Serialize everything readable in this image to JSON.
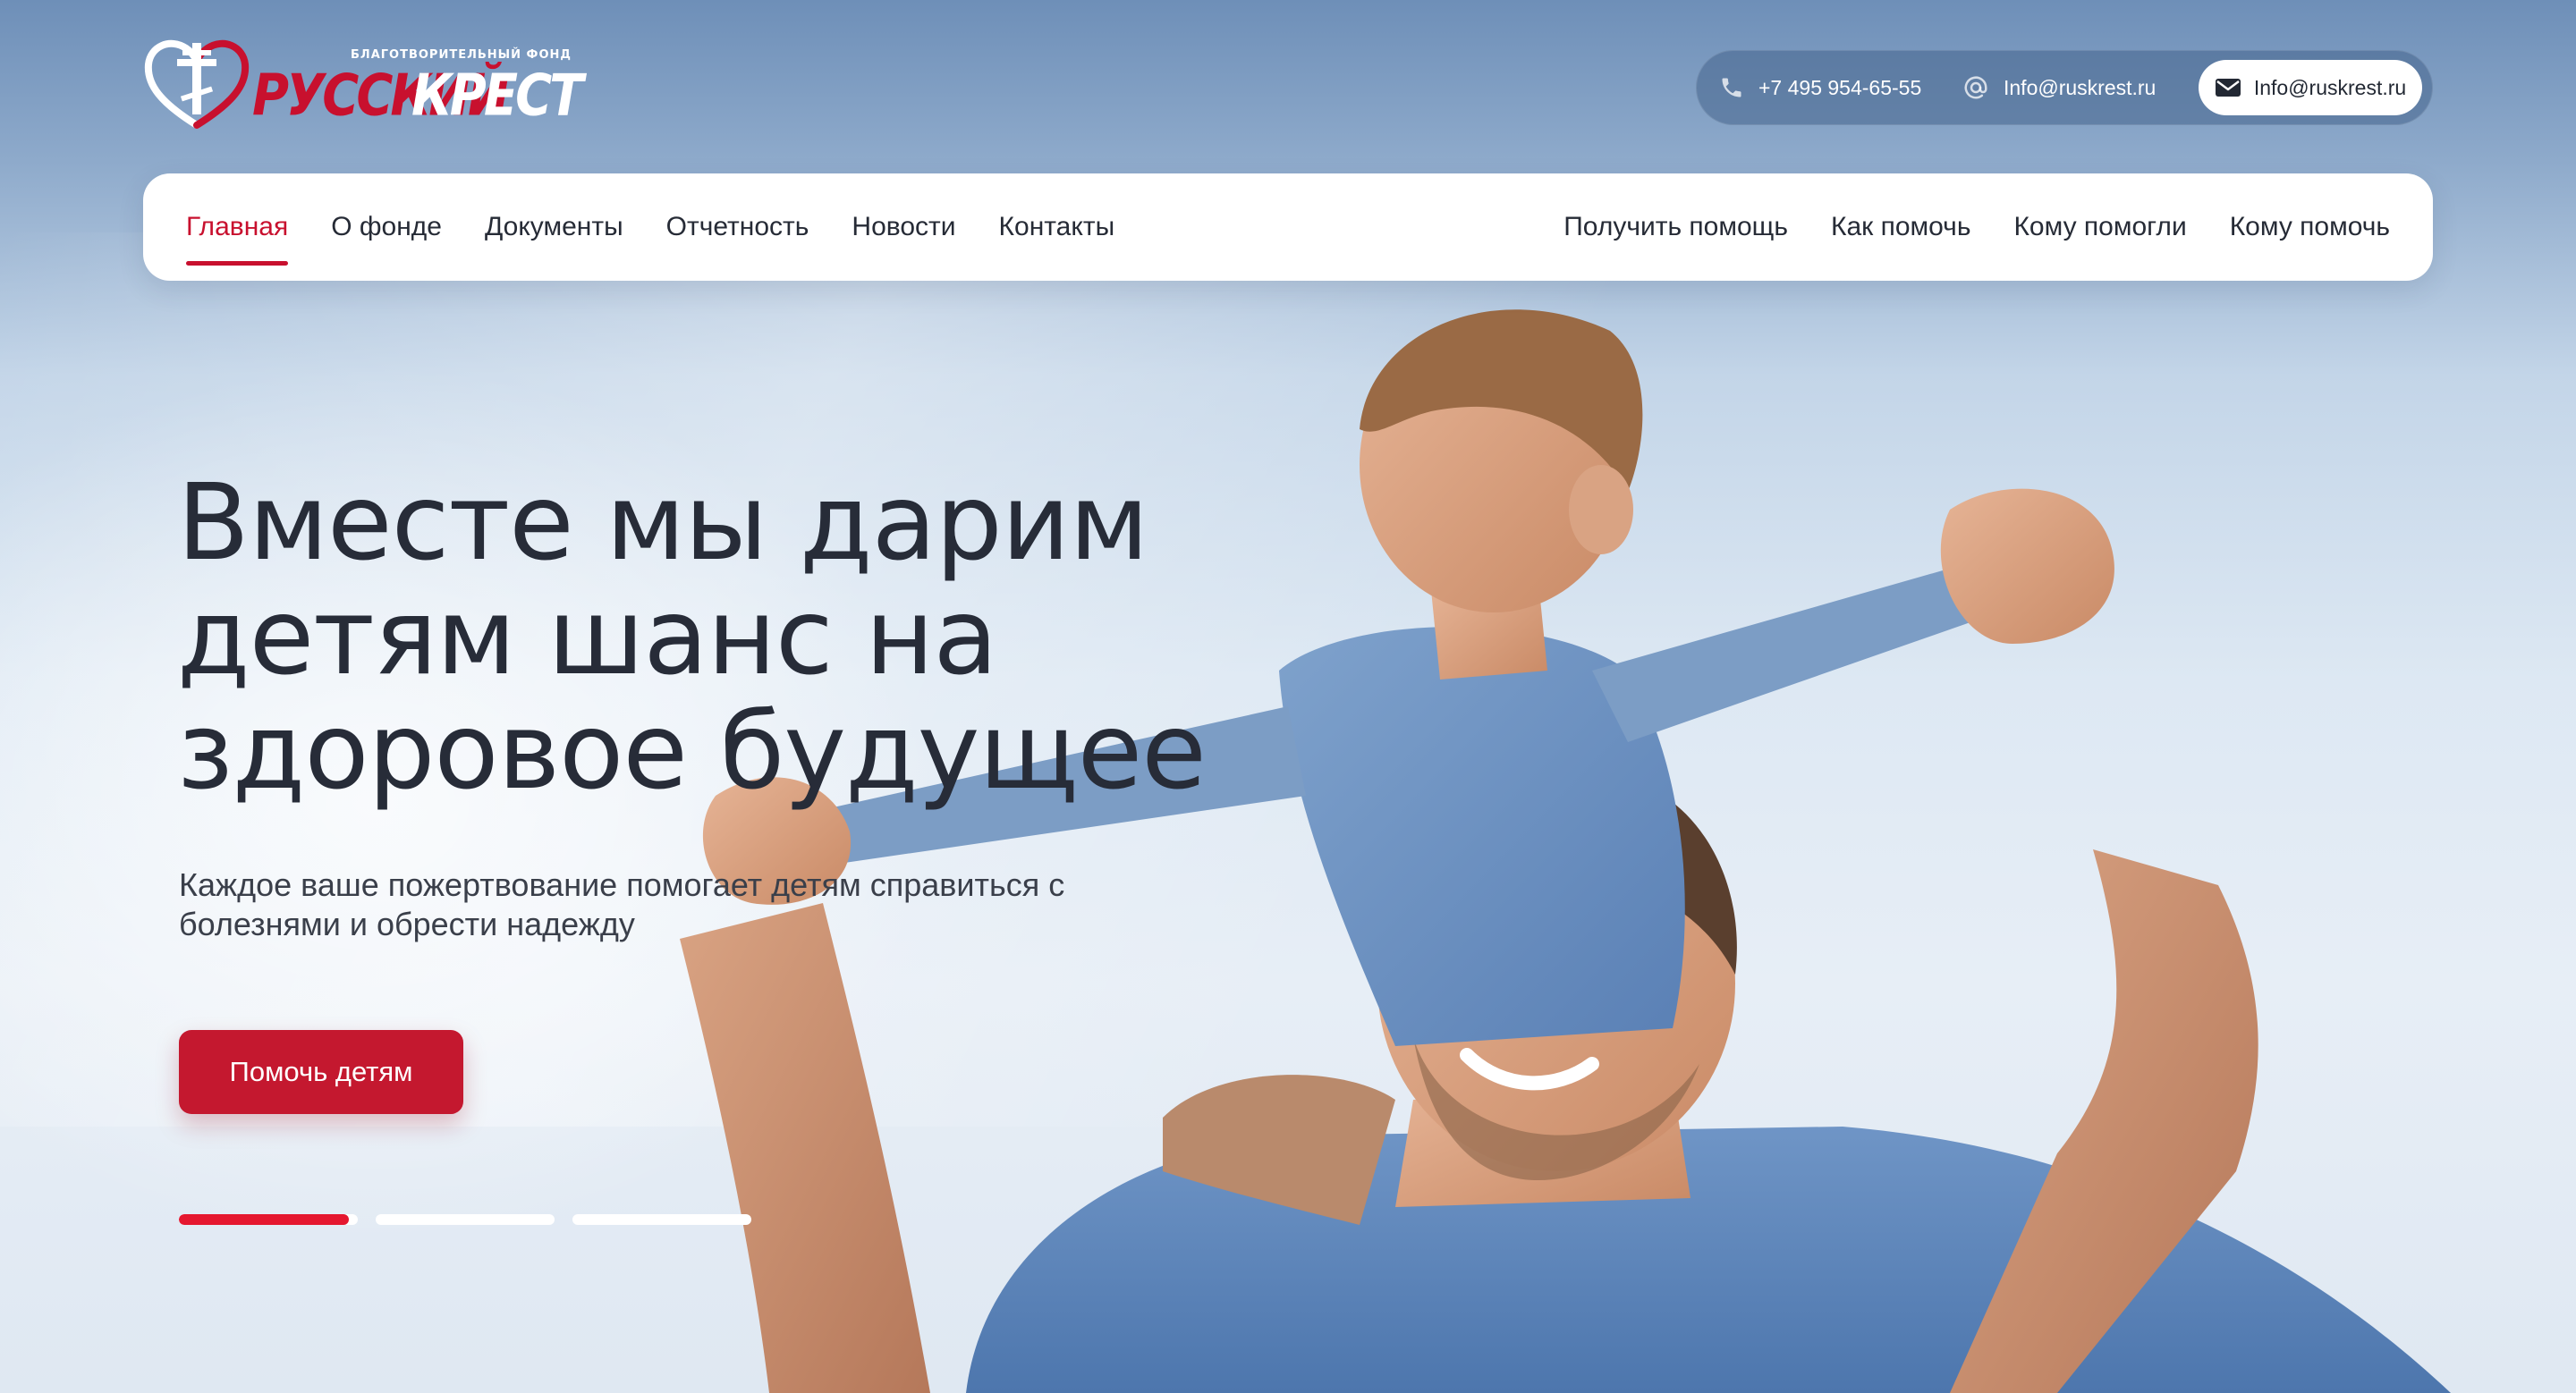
{
  "brand": {
    "tagline": "БЛАГОТВОРИТЕЛЬНЫЙ ФОНД",
    "name_part1": "РУССКИЙ",
    "name_part2": "КРЕСТ",
    "primary_color": "#c8102e",
    "logo_icon": "heart-cross-logo-icon"
  },
  "contacts": {
    "phone": "+7 495 954-65-55",
    "email": "Info@ruskrest.ru",
    "email_button_label": "Info@ruskrest.ru",
    "icons": [
      "phone-icon",
      "at-sign-icon",
      "envelope-icon"
    ]
  },
  "nav": {
    "left": [
      {
        "label": "Главная",
        "active": true
      },
      {
        "label": "О фонде"
      },
      {
        "label": "Документы"
      },
      {
        "label": "Отчетность"
      },
      {
        "label": "Новости"
      },
      {
        "label": "Контакты"
      }
    ],
    "right": [
      {
        "label": "Получить помощь"
      },
      {
        "label": "Как помочь"
      },
      {
        "label": "Кому помогли"
      },
      {
        "label": "Кому помочь"
      }
    ]
  },
  "hero": {
    "title_lines": [
      "Вместе мы дарим",
      "детям шанс на",
      "здоровое будущее"
    ],
    "subtitle_lines": [
      "Каждое ваше пожертвование помогает детям справиться с",
      "болезнями и обрести надежду"
    ],
    "cta_label": "Помочь детям",
    "image": "father-carrying-son-on-shoulders-photo"
  },
  "slider": {
    "slides": [
      {
        "progress": 0.95
      },
      {
        "progress": 0
      },
      {
        "progress": 0
      }
    ]
  }
}
